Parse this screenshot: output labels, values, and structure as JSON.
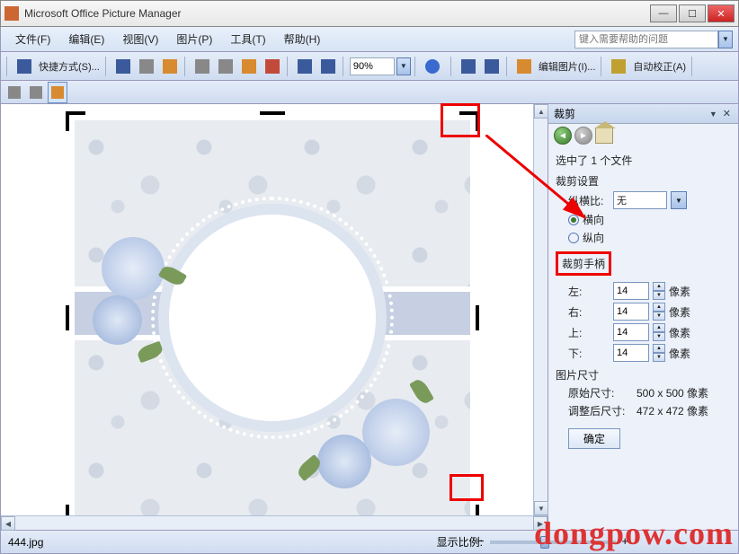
{
  "title": "Microsoft Office Picture Manager",
  "menus": [
    "文件(F)",
    "编辑(E)",
    "视图(V)",
    "图片(P)",
    "工具(T)",
    "帮助(H)"
  ],
  "help_placeholder": "键入需要帮助的问题",
  "toolbar1": {
    "shortcut": "快捷方式(S)...",
    "zoom": "90%"
  },
  "toolbar2": {
    "edit_pic": "编辑图片(I)...",
    "auto_correct": "自动校正(A)"
  },
  "panel": {
    "title": "裁剪",
    "selected": "选中了 1 个文件",
    "crop_settings": "裁剪设置",
    "aspect_label": "纵横比:",
    "aspect_value": "无",
    "orient_h": "横向",
    "orient_v": "纵向",
    "crop_handle": "裁剪手柄",
    "left_label": "左:",
    "left_val": "14",
    "right_label": "右:",
    "right_val": "14",
    "top_label": "上:",
    "top_val": "14",
    "bottom_label": "下:",
    "bottom_val": "14",
    "px": "像素",
    "pic_size": "图片尺寸",
    "orig_label": "原始尺寸:",
    "orig_val": "500 x 500 像素",
    "resize_label": "调整后尺寸:",
    "resize_val": "472 x 472 像素",
    "ok": "确定"
  },
  "status": {
    "filename": "444.jpg",
    "zoom_label": "显示比例:"
  },
  "watermark": "dongpow.com"
}
